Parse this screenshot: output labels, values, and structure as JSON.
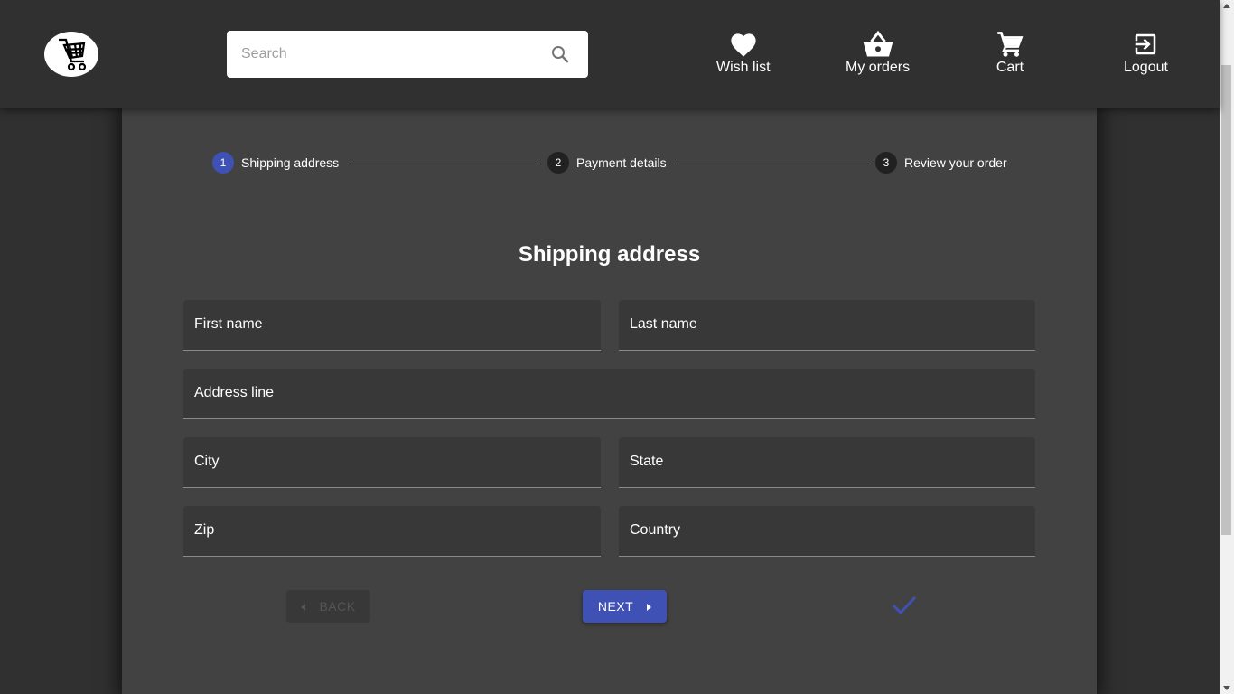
{
  "header": {
    "logo_icon": "shopping-cart-logo-icon",
    "search": {
      "placeholder": "Search",
      "value": "",
      "icon": "search-icon"
    },
    "nav": [
      {
        "label": "Wish list",
        "icon": "heart-icon"
      },
      {
        "label": "My orders",
        "icon": "basket-icon"
      },
      {
        "label": "Cart",
        "icon": "cart-icon"
      },
      {
        "label": "Logout",
        "icon": "logout-icon"
      }
    ]
  },
  "stepper": {
    "steps": [
      {
        "number": "1",
        "label": "Shipping address",
        "active": true
      },
      {
        "number": "2",
        "label": "Payment details",
        "active": false
      },
      {
        "number": "3",
        "label": "Review your order",
        "active": false
      }
    ]
  },
  "form": {
    "title": "Shipping address",
    "fields": {
      "first_name": "First name",
      "last_name": "Last name",
      "address_line": "Address line",
      "city": "City",
      "state": "State",
      "zip": "Zip",
      "country": "Country"
    },
    "back_label": "BACK",
    "next_label": "NEXT"
  },
  "colors": {
    "accent": "#3f51b5",
    "background": "#303030",
    "panel": "#424242"
  }
}
